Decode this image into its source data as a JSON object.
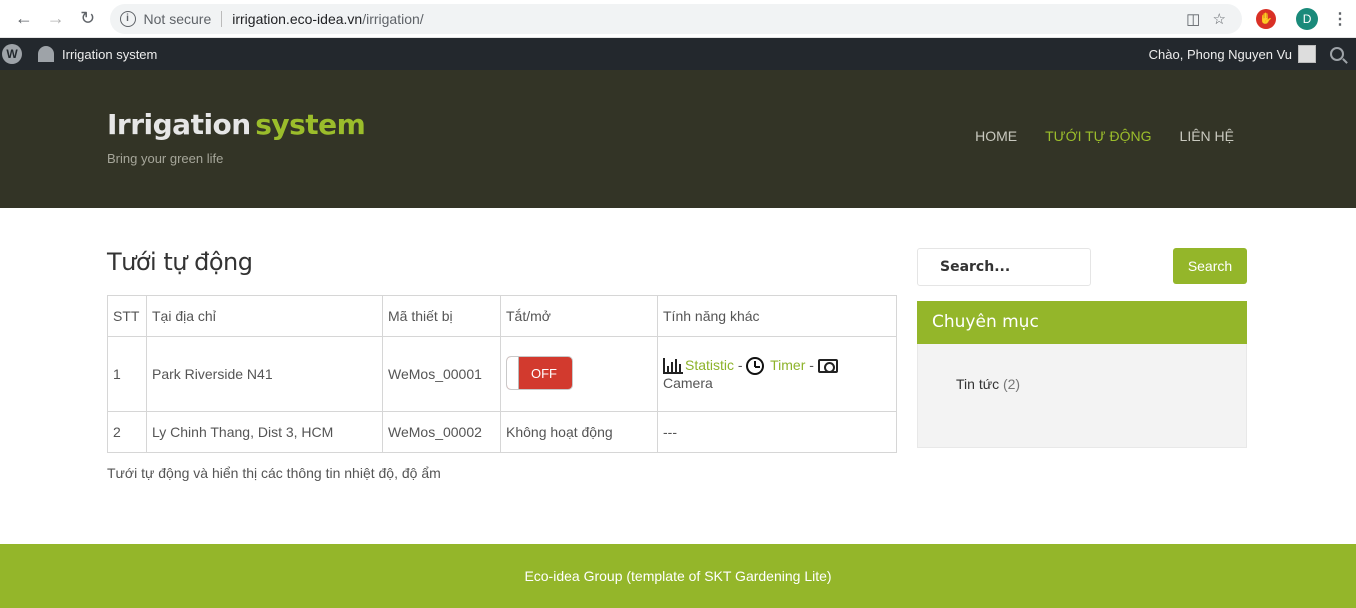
{
  "browser": {
    "security": "Not secure",
    "url_host": "irrigation.eco-idea.vn",
    "url_path": "/irrigation/",
    "profile_initial": "D"
  },
  "adminbar": {
    "site_name": "Irrigation system",
    "greeting": "Chào, Phong Nguyen Vu"
  },
  "header": {
    "title_part1": "Irrigation",
    "title_part2": "system",
    "tagline": "Bring your green life",
    "nav": [
      "HOME",
      "TƯỚI TỰ ĐỘNG",
      "LIÊN HỆ"
    ]
  },
  "main": {
    "page_title": "Tưới tự động",
    "columns": [
      "STT",
      "Tại địa chỉ",
      "Mã thiết bị",
      "Tắt/mở",
      "Tính năng khác"
    ],
    "rows": [
      {
        "stt": "1",
        "address": "Park Riverside N41",
        "device": "WeMos_00001",
        "toggle": "OFF",
        "features": {
          "statistic": "Statistic",
          "timer": "Timer",
          "camera": "Camera",
          "sep": "-"
        }
      },
      {
        "stt": "2",
        "address": "Ly Chinh Thang, Dist 3, HCM",
        "device": "WeMos_00002",
        "status": "Không hoạt động",
        "features": "---"
      }
    ],
    "description": "Tưới tự động và hiển thị các thông tin nhiệt độ, độ ẩm"
  },
  "sidebar": {
    "search_placeholder": "Search...",
    "search_button": "Search",
    "widget_title": "Chuyên mục",
    "category": "Tin tức",
    "category_count": "(2)"
  },
  "footer": {
    "text": "Eco-idea Group (template of SKT Gardening Lite)"
  }
}
